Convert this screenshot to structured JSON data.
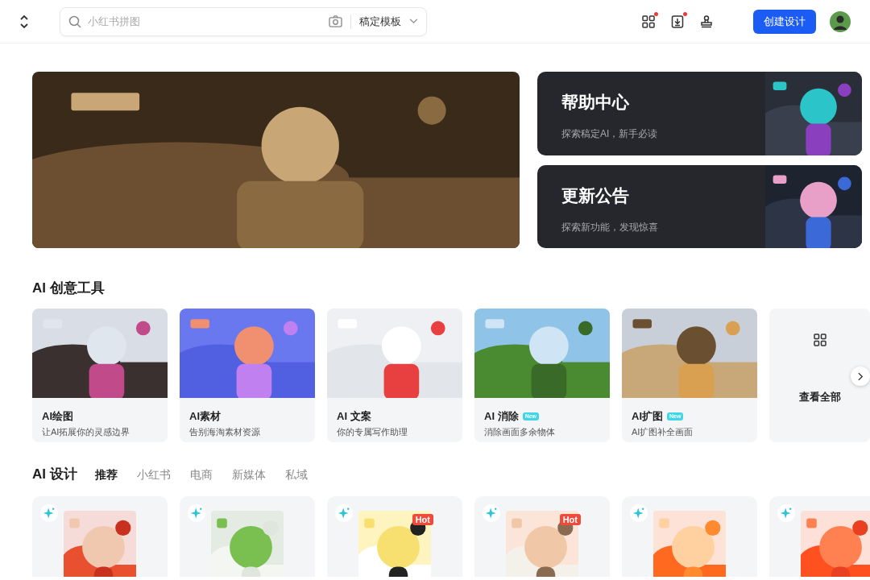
{
  "header": {
    "search": {
      "placeholder": "小红书拼图"
    },
    "scope": "稿定模板",
    "icons": [
      {
        "kind": "apps",
        "dot": true
      },
      {
        "kind": "download",
        "dot": true
      },
      {
        "kind": "stamp",
        "dot": false
      }
    ],
    "create_button": "创建设计"
  },
  "info_cards": [
    {
      "title": "帮助中心",
      "subtitle": "探索稿定AI，新手必读"
    },
    {
      "title": "更新公告",
      "subtitle": "探索新功能，发现惊喜"
    }
  ],
  "creative_tools": {
    "title": "AI 创意工具",
    "items": [
      {
        "kind": "tool",
        "title": "AI绘图",
        "subtitle": "让AI拓展你的灵感边界"
      },
      {
        "kind": "tool",
        "title": "AI素材",
        "subtitle": "告别海淘素材资源"
      },
      {
        "kind": "tool",
        "title": "AI 文案",
        "subtitle": "你的专属写作助理"
      },
      {
        "kind": "tool",
        "title": "AI 消除",
        "badge": "New",
        "subtitle": "消除画面多余物体"
      },
      {
        "kind": "tool",
        "title": "AI扩图",
        "badge": "New",
        "subtitle": "AI扩图补全画面"
      },
      {
        "kind": "view_all",
        "title": "查看全部"
      }
    ]
  },
  "ai_design": {
    "title": "AI 设计",
    "tabs": [
      {
        "label": "推荐",
        "selected": true
      },
      {
        "label": "小红书",
        "selected": false
      },
      {
        "label": "电商",
        "selected": false
      },
      {
        "label": "新媒体",
        "selected": false
      },
      {
        "label": "私域",
        "selected": false
      }
    ],
    "templates": [
      {
        "kind": "template"
      },
      {
        "kind": "template"
      },
      {
        "kind": "template",
        "badge": "Hot"
      },
      {
        "kind": "template",
        "badge": "Hot"
      },
      {
        "kind": "template"
      },
      {
        "kind": "template"
      }
    ]
  }
}
